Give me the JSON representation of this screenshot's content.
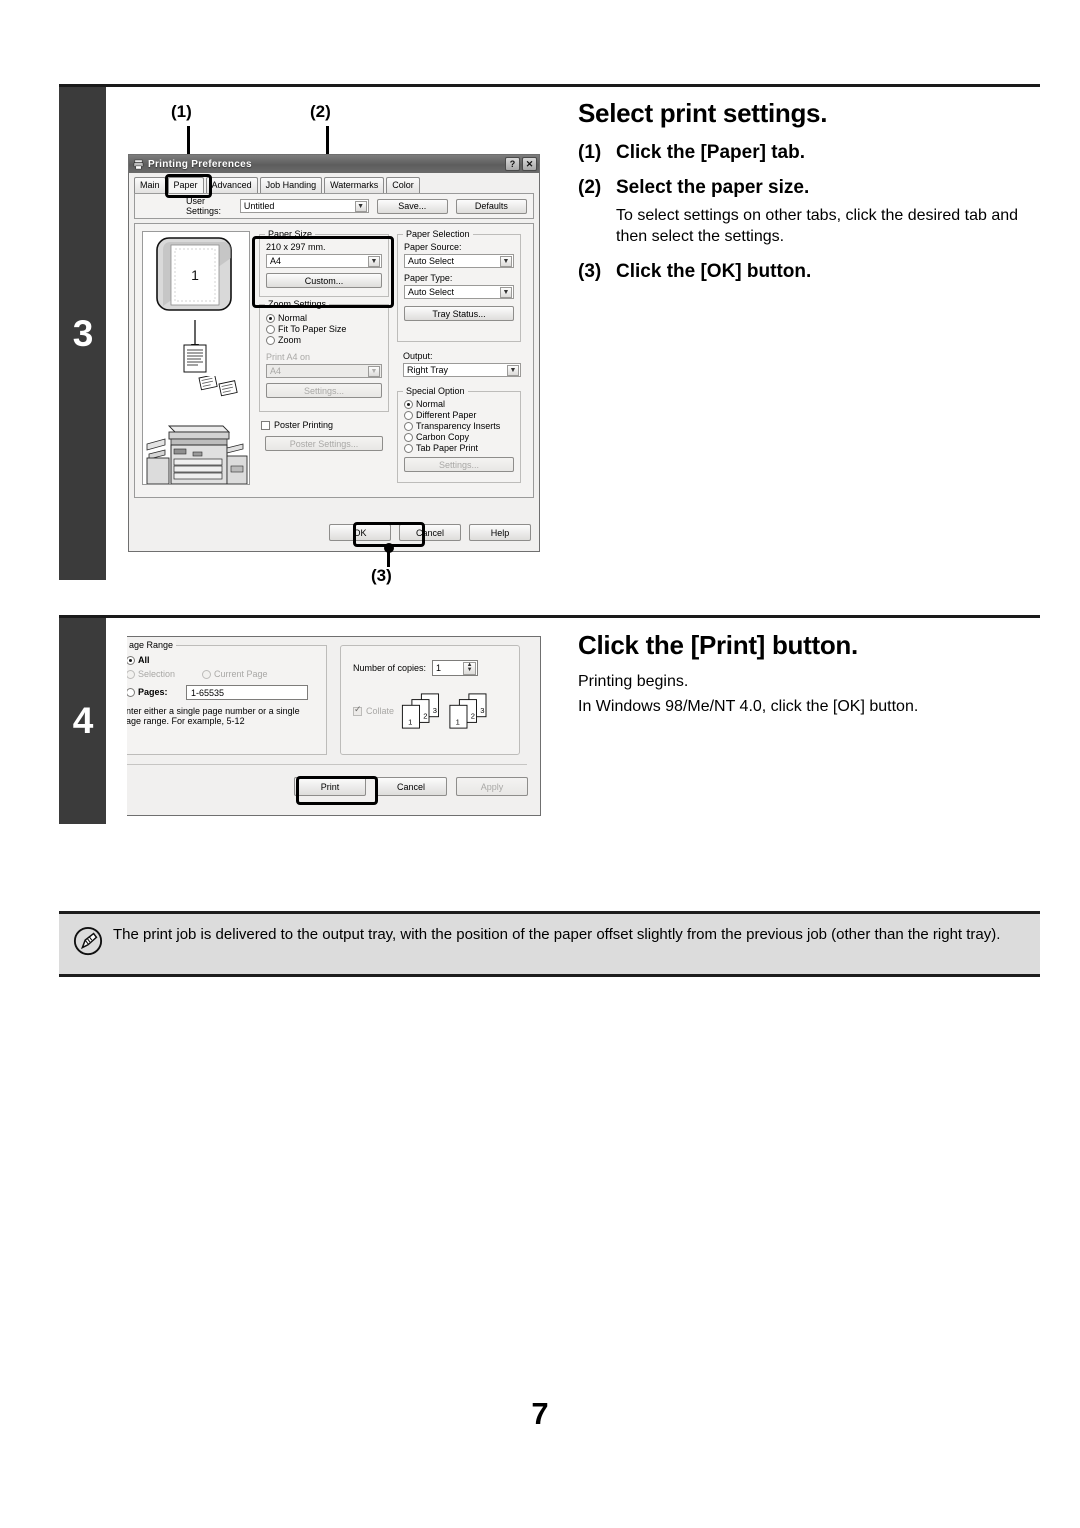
{
  "page": {
    "number": "7"
  },
  "steps": [
    {
      "number": "3",
      "heading": "Select print settings.",
      "items": [
        {
          "n": "(1)",
          "text": "Click the [Paper] tab."
        },
        {
          "n": "(2)",
          "text": "Select the paper size.",
          "sub": "To select settings on other tabs, click the desired tab and then select the settings."
        },
        {
          "n": "(3)",
          "text": "Click the [OK] button."
        }
      ]
    },
    {
      "number": "4",
      "heading": "Click the [Print] button.",
      "body_line1": "Printing begins.",
      "body_line2": "In Windows 98/Me/NT 4.0, click the [OK] button."
    }
  ],
  "callouts": {
    "one": "(1)",
    "two": "(2)",
    "three": "(3)"
  },
  "printing_preferences": {
    "title": "Printing Preferences",
    "help_button": "?",
    "close_button": "✕",
    "tabs": [
      {
        "label": "Main",
        "selected": false
      },
      {
        "label": "Paper",
        "selected": true
      },
      {
        "label": "Advanced",
        "selected": false
      },
      {
        "label": "Job Handing",
        "selected": false
      },
      {
        "label": "Watermarks",
        "selected": false
      },
      {
        "label": "Color",
        "selected": false
      }
    ],
    "user_settings": {
      "label": "User Settings:",
      "value": "Untitled",
      "save_button": "Save...",
      "defaults_button": "Defaults"
    },
    "preview": {
      "page_label": "1"
    },
    "paper_size": {
      "legend": "Paper Size",
      "dimensions": "210 x 297 mm.",
      "value": "A4",
      "custom_button": "Custom..."
    },
    "zoom_settings": {
      "legend": "Zoom Settings",
      "options": [
        {
          "label": "Normal",
          "selected": true
        },
        {
          "label": "Fit To Paper Size",
          "selected": false
        },
        {
          "label": "Zoom",
          "selected": false
        }
      ],
      "print_on_label": "Print A4 on",
      "print_on_value": "A4",
      "settings_button": "Settings..."
    },
    "poster": {
      "checkbox_label": "Poster Printing",
      "checked": false,
      "settings_button": "Poster Settings..."
    },
    "paper_selection": {
      "legend": "Paper Selection",
      "source_label": "Paper Source:",
      "source_value": "Auto Select",
      "type_label": "Paper Type:",
      "type_value": "Auto Select",
      "tray_status_button": "Tray Status..."
    },
    "output": {
      "label": "Output:",
      "value": "Right Tray"
    },
    "special_option": {
      "legend": "Special Option",
      "options": [
        {
          "label": "Normal",
          "selected": true
        },
        {
          "label": "Different Paper",
          "selected": false
        },
        {
          "label": "Transparency Inserts",
          "selected": false
        },
        {
          "label": "Carbon Copy",
          "selected": false
        },
        {
          "label": "Tab Paper Print",
          "selected": false
        }
      ],
      "settings_button": "Settings..."
    },
    "buttons": {
      "ok": "OK",
      "cancel": "Cancel",
      "help": "Help"
    }
  },
  "print_dialog": {
    "page_range": {
      "legend": "age Range",
      "all": "All",
      "selection": "Selection",
      "current_page": "Current Page",
      "pages_label": "Pages:",
      "pages_value": "1-65535",
      "hint_line1": "nter either a single page number or a single",
      "hint_line2": "age range.  For example, 5-12"
    },
    "copies": {
      "label": "Number of copies:",
      "value": "1",
      "collate_label": "Collate",
      "collate_checked": true,
      "stack_pages": [
        "1",
        "2",
        "3"
      ]
    },
    "buttons": {
      "print": "Print",
      "cancel": "Cancel",
      "apply": "Apply"
    }
  },
  "note": {
    "text": "The print job is delivered to the output tray, with the position of the paper offset slightly from the previous job (other than the right tray)."
  }
}
